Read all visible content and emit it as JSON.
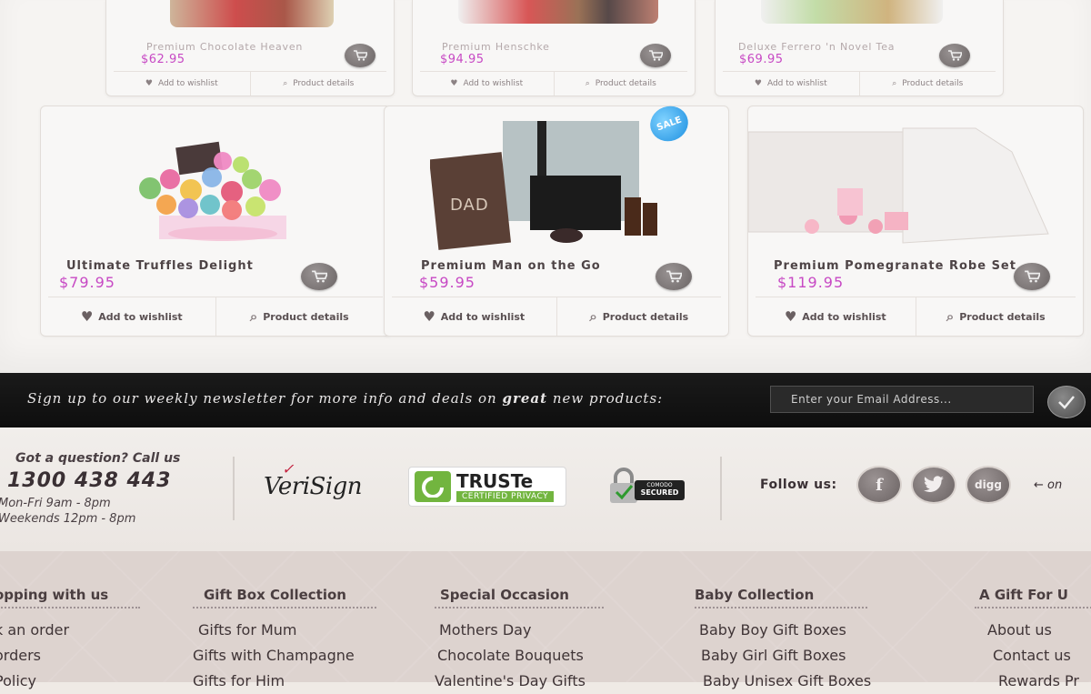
{
  "top_row": [
    {
      "name": "Premium Chocolate Heaven",
      "price": "$62.95",
      "wishlist": "Add to wishlist",
      "details": "Product details"
    },
    {
      "name": "Premium Henschke",
      "price": "$94.95",
      "wishlist": "Add to wishlist",
      "details": "Product details"
    },
    {
      "name": "Deluxe Ferrero 'n Novel Tea",
      "price": "$69.95",
      "wishlist": "Add to wishlist",
      "details": "Product details"
    }
  ],
  "products": [
    {
      "name": "Ultimate Truffles Delight",
      "price": "$79.95",
      "wishlist": "Add to wishlist",
      "details": "Product details"
    },
    {
      "name": "Premium Man on the Go",
      "price": "$59.95",
      "wishlist": "Add to wishlist",
      "details": "Product details",
      "badge": "SALE",
      "box_label": "DAD"
    },
    {
      "name": "Premium Pomegranate Robe Set",
      "price": "$119.95",
      "wishlist": "Add to wishlist",
      "details": "Product details"
    }
  ],
  "newsletter": {
    "text_before": "Sign up to our weekly newsletter for more info and deals on ",
    "text_bold": "great",
    "text_after": " new products:",
    "placeholder": "Enter your Email Address..."
  },
  "contact": {
    "title": "Got a question? Call us",
    "phone": "1300 438 443",
    "hours_weekday": "Mon-Fri 9am - 8pm",
    "hours_weekend": "Weekends 12pm - 8pm"
  },
  "badges": {
    "verisign": "VeriSign",
    "truste_name": "TRUSTe",
    "truste_sub": "CERTIFIED PRIVACY",
    "comodo_line1": "COMODO",
    "comodo_line2": "SECURED"
  },
  "social": {
    "label": "Follow us:",
    "facebook": "f",
    "digg": "digg",
    "note": "← on"
  },
  "footer": {
    "columns": [
      {
        "heading": "opping with us",
        "links": [
          "k an order",
          "orders",
          "Policy"
        ]
      },
      {
        "heading": "Gift Box Collection",
        "links": [
          "Gifts for Mum",
          "Gifts with Champagne",
          "Gifts for Him"
        ]
      },
      {
        "heading": "Special Occasion",
        "links": [
          "Mothers Day",
          "Chocolate Bouquets",
          "Valentine's Day Gifts"
        ]
      },
      {
        "heading": "Baby Collection",
        "links": [
          "Baby Boy Gift Boxes",
          "Baby Girl Gift Boxes",
          "Baby Unisex Gift Boxes"
        ]
      },
      {
        "heading": "A Gift For U",
        "links": [
          "About us",
          "Contact us",
          "Rewards Pr"
        ]
      }
    ]
  },
  "colors": {
    "price": "#c749c4",
    "newsletter_bg": "#111111",
    "footer_bg": "#ddd3cf",
    "truste_green": "#72b53f",
    "verisign_red": "#c31e3b"
  }
}
